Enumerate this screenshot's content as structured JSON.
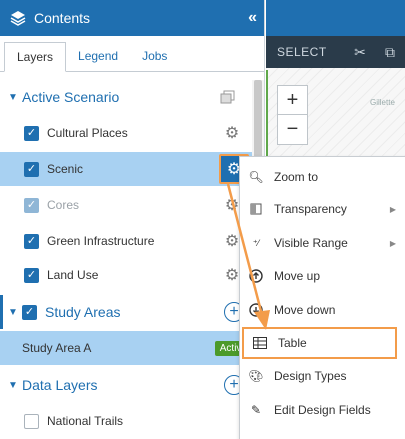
{
  "panel": {
    "title": "Contents",
    "collapse_label": "«",
    "tabs": [
      {
        "label": "Layers"
      },
      {
        "label": "Legend"
      },
      {
        "label": "Jobs"
      }
    ]
  },
  "tree": {
    "active_scenario": {
      "label": "Active Scenario"
    },
    "layers": [
      {
        "label": "Cultural Places",
        "checked": true
      },
      {
        "label": "Scenic",
        "checked": true,
        "selected": true
      },
      {
        "label": "Cores",
        "checked": true,
        "dimmed": true
      },
      {
        "label": "Green Infrastructure",
        "checked": true
      },
      {
        "label": "Land Use",
        "checked": true
      }
    ],
    "study_areas": {
      "label": "Study Areas"
    },
    "study_area_item": {
      "label": "Study Area A",
      "badge": "Active"
    },
    "data_layers": {
      "label": "Data Layers"
    },
    "national_trails": {
      "label": "National Trails"
    }
  },
  "map": {
    "select_label": "SELECT",
    "zoom_in": "+",
    "zoom_out": "−",
    "place_label": "Gillette"
  },
  "context_menu": {
    "items": [
      {
        "label": "Zoom to",
        "icon": "zoom-icon"
      },
      {
        "label": "Transparency",
        "icon": "transparency-icon",
        "submenu": true
      },
      {
        "label": "Visible Range",
        "icon": "visible-range-icon",
        "submenu": true
      },
      {
        "label": "Move up",
        "icon": "move-up-icon"
      },
      {
        "label": "Move down",
        "icon": "move-down-icon"
      },
      {
        "label": "Table",
        "icon": "table-icon",
        "highlighted": true
      },
      {
        "label": "Design Types",
        "icon": "palette-icon"
      },
      {
        "label": "Edit Design Fields",
        "icon": "pencil-icon"
      }
    ]
  },
  "colors": {
    "brand_blue": "#1f6fb0",
    "selection_blue": "#a8d1f2",
    "highlight_orange": "#f39c4a",
    "active_green": "#4c9a2a"
  }
}
